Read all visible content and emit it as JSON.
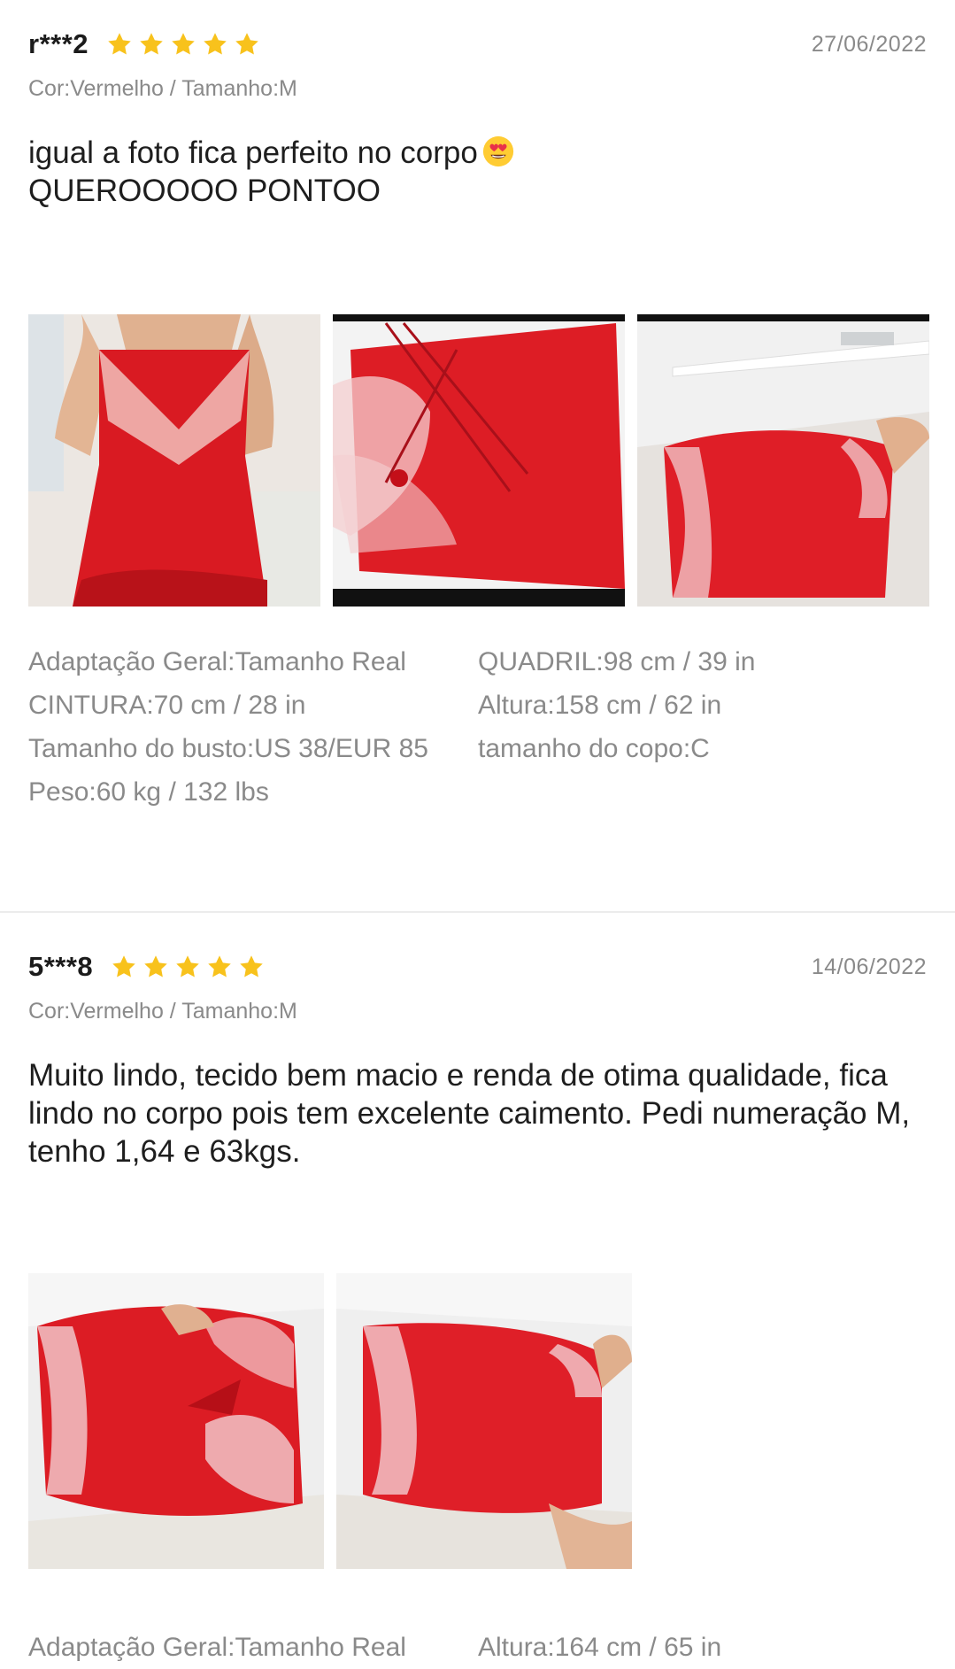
{
  "colors": {
    "star": "#f8c21c",
    "username": "#1b1b1b",
    "muted": "#8a8a8a",
    "text": "#1e1e1e"
  },
  "reviews": [
    {
      "username": "r***2",
      "rating": 5,
      "date": "27/06/2022",
      "variant": "Cor:Vermelho / Tamanho:M",
      "comment_line1": "igual a foto fica perfeito no corpo",
      "comment_emoji": "heart-eyes-emoji",
      "comment_line2": "QUEROOOOO PONTOO",
      "photo_count": 3,
      "specs_left": [
        "Adaptação Geral:Tamanho Real",
        "CINTURA:70 cm / 28 in",
        "Tamanho do busto:US 38/EUR 85",
        "Peso:60 kg / 132 lbs"
      ],
      "specs_right": [
        "QUADRIL:98 cm / 39 in",
        "Altura:158 cm / 62 in",
        "tamanho do copo:C"
      ]
    },
    {
      "username": "5***8",
      "rating": 5,
      "date": "14/06/2022",
      "variant": "Cor:Vermelho / Tamanho:M",
      "comment": "Muito lindo, tecido bem macio e renda de otima qualidade, fica lindo no corpo pois tem excelente caimento. Pedi numeração M, tenho 1,64 e 63kgs.",
      "photo_count": 2,
      "specs_left": [
        "Adaptação Geral:Tamanho Real"
      ],
      "specs_right": [
        "Altura:164 cm / 65 in"
      ]
    }
  ]
}
